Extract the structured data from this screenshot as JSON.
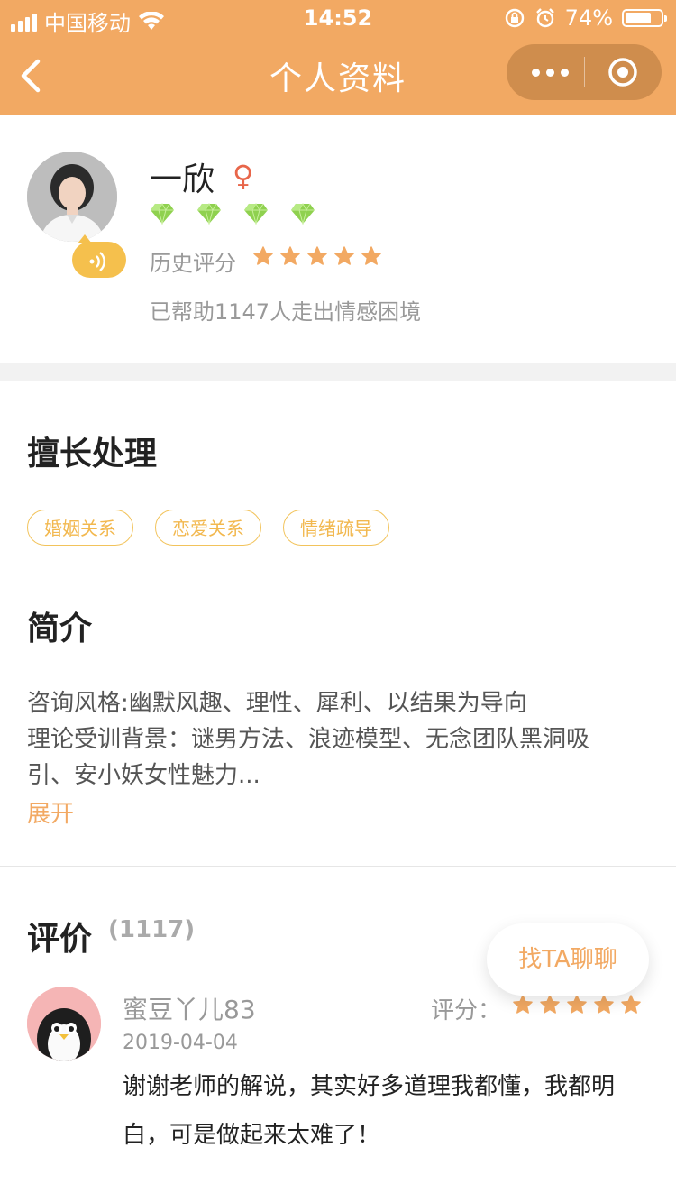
{
  "status_bar": {
    "carrier": "中国移动",
    "time": "14:52",
    "battery_text": "74%",
    "battery_level": 0.74
  },
  "nav": {
    "title": "个人资料"
  },
  "profile": {
    "name": "一欣",
    "gender_symbol": "♀",
    "diamond_count": 4,
    "rating_label": "历史评分",
    "rating_stars": 5,
    "helped_text": "已帮助1147人走出情感困境"
  },
  "expertise": {
    "title": "擅长处理",
    "tags": [
      "婚姻关系",
      "恋爱关系",
      "情绪疏导"
    ]
  },
  "intro": {
    "title": "简介",
    "lines": [
      "咨询风格:幽默风趣、理性、犀利、以结果为导向",
      "理论受训背景：谜男方法、浪迹模型、无念团队黑洞吸",
      "引、安小妖女性魅力..."
    ],
    "expand_label": "展开"
  },
  "reviews": {
    "title": "评价",
    "count": "(1117)",
    "chat_button": "找TA聊聊",
    "items": [
      {
        "name": "蜜豆丫儿83",
        "score_label": "评分：",
        "stars": 5,
        "date": "2019-04-04",
        "text": "谢谢老师的解说，其实好多道理我都懂，我都明白，可是做起来太难了！"
      }
    ]
  },
  "colors": {
    "brand": "#f2a963",
    "tag_border": "#f2c35b",
    "gender": "#e8664a",
    "diamond": "#8fd14f"
  }
}
